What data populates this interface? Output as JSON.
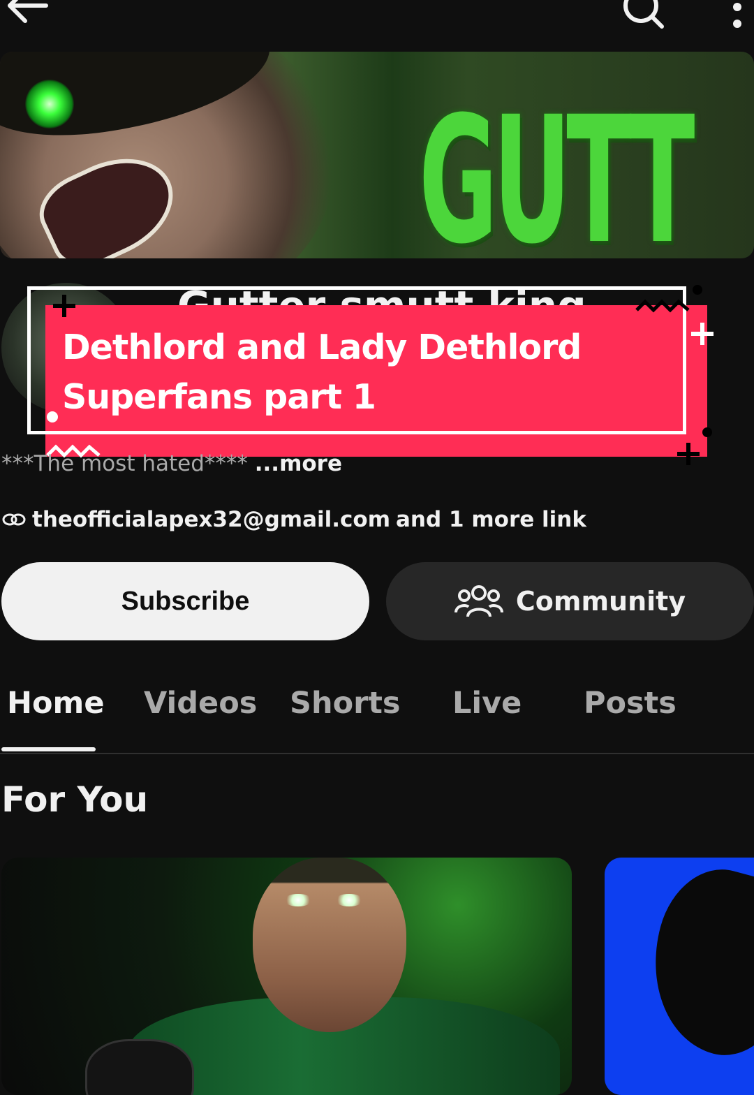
{
  "topbar": {
    "back_icon": "arrow-left-icon",
    "search_icon": "search-icon",
    "more_icon": "more-vertical-icon"
  },
  "banner": {
    "logo_text": "GUTT"
  },
  "channel": {
    "name": "Gutter smutt king",
    "description": "***The most hated****",
    "more_label": "...more",
    "link_icon": "link-icon",
    "link_email": "theofficialapex32@gmail.com",
    "link_more": "and 1 more link"
  },
  "overlay": {
    "title": "Dethlord and Lady Dethlord Superfans part 1",
    "color": "#ff2d55"
  },
  "actions": {
    "subscribe_label": "Subscribe",
    "community_label": "Community",
    "community_icon": "people-icon"
  },
  "tabs": [
    {
      "label": "Home",
      "active": true
    },
    {
      "label": "Videos",
      "active": false
    },
    {
      "label": "Shorts",
      "active": false
    },
    {
      "label": "Live",
      "active": false
    },
    {
      "label": "Posts",
      "active": false
    }
  ],
  "section": {
    "title": "For You"
  }
}
